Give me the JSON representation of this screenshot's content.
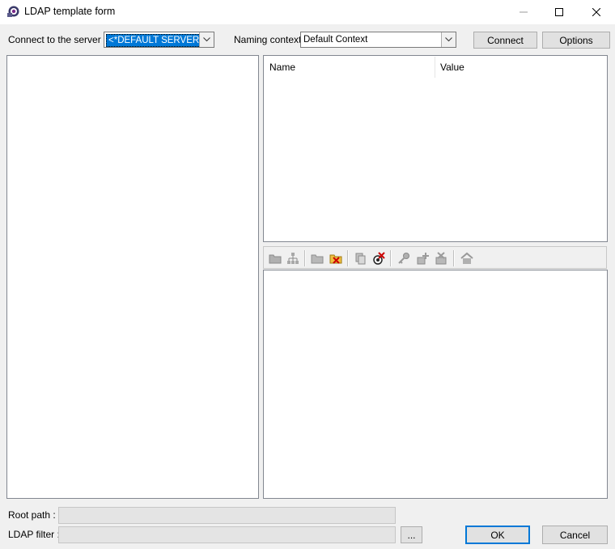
{
  "window": {
    "title": "LDAP template form",
    "icons": {
      "app": "ldap-app-icon",
      "minimize": "minimize-icon",
      "maximize": "maximize-icon",
      "close": "close-icon"
    }
  },
  "connection": {
    "server_label": "Connect to the server :",
    "server_value": "<*DEFAULT SERVER*>",
    "naming_label": "Naming context :",
    "naming_value": "Default Context",
    "connect_label": "Connect",
    "options_label": "Options"
  },
  "attributes": {
    "columns": [
      "Name",
      "Value"
    ]
  },
  "toolbar": {
    "buttons": [
      "open-folder-icon",
      "tree-structure-icon",
      "folder-icon",
      "folder-delete-icon",
      "copy-entry-icon",
      "delete-entry-icon",
      "key-icon",
      "add-attribute-icon",
      "delete-attribute-icon",
      "home-icon"
    ]
  },
  "bottom": {
    "root_path_label": "Root path :",
    "root_path_value": "",
    "ldap_filter_label": "LDAP filter :",
    "ldap_filter_value": "",
    "browse_label": "...",
    "ok_label": "OK",
    "cancel_label": "Cancel"
  },
  "colors": {
    "accent": "#0078d7",
    "window_bg": "#f0f0f0"
  }
}
